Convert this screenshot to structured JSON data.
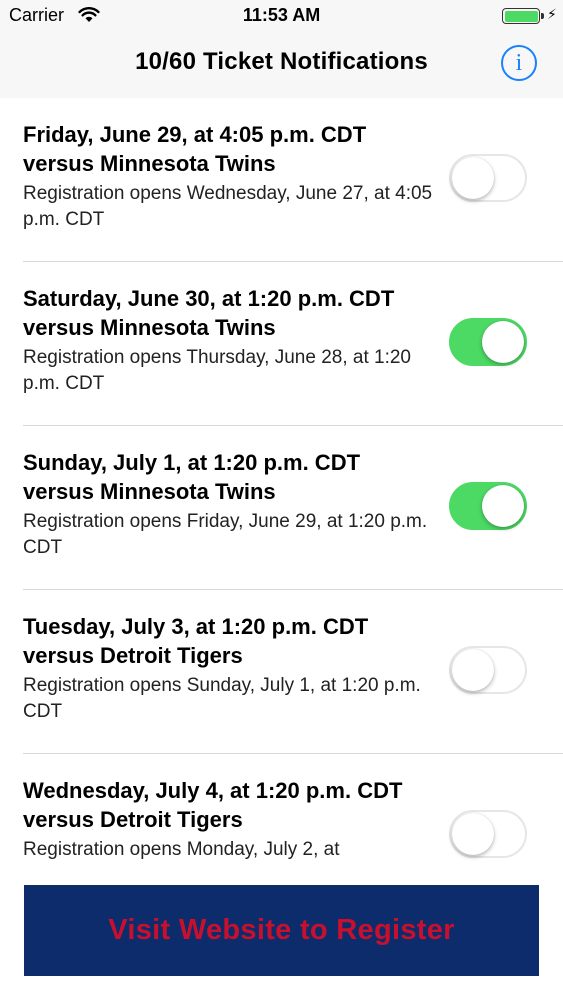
{
  "status_bar": {
    "carrier": "Carrier",
    "time": "11:53 AM",
    "battery_color": "#4cd964"
  },
  "nav": {
    "title": "10/60 Ticket Notifications",
    "info_icon": "i"
  },
  "games": [
    {
      "title": "Friday, June 29, at 4:05 p.m. CDT versus Minnesota Twins",
      "subtitle": "Registration opens Wednesday, June 27, at 4:05 p.m. CDT",
      "enabled": false
    },
    {
      "title": "Saturday, June 30, at 1:20 p.m. CDT versus Minnesota Twins",
      "subtitle": "Registration opens Thursday, June 28, at 1:20 p.m. CDT",
      "enabled": true
    },
    {
      "title": "Sunday, July 1, at 1:20 p.m. CDT versus Minnesota Twins",
      "subtitle": "Registration opens Friday, June 29, at 1:20 p.m. CDT",
      "enabled": true
    },
    {
      "title": "Tuesday, July 3, at 1:20 p.m. CDT versus Detroit Tigers",
      "subtitle": "Registration opens Sunday, July 1, at 1:20 p.m. CDT",
      "enabled": false
    },
    {
      "title": "Wednesday, July 4, at 1:20 p.m. CDT versus Detroit Tigers",
      "subtitle": "Registration opens Monday, July 2, at",
      "enabled": false
    }
  ],
  "register_button": {
    "label": "Visit Website to Register",
    "background": "#0c2c6b",
    "text_color": "#c8102e"
  }
}
